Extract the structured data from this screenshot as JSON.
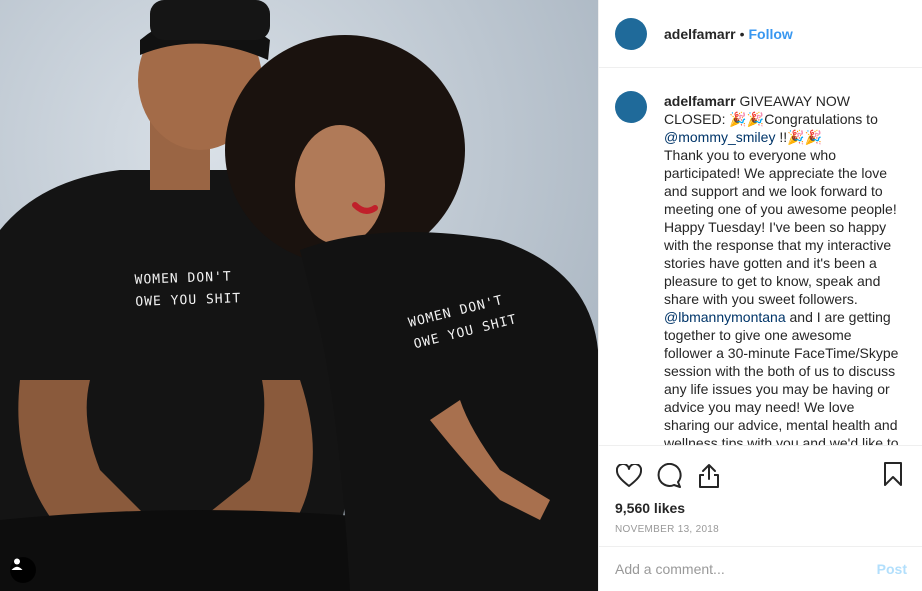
{
  "post": {
    "username": "adelfamarr",
    "follow_label": "Follow",
    "separator": "•",
    "avatar_color": "#1f6a9a"
  },
  "photo": {
    "shirt_text_left": "WOMEN DON'T\nOWE YOU SHIT",
    "shirt_text_right": "WOMEN DON'T\nOWE YOU SHIT",
    "user_tag_icon": "person-icon"
  },
  "caption": {
    "username": "adelfamarr",
    "line1": "GIVEAWAY NOW CLOSED:",
    "emoji": "🎉🎉",
    "congrats": "Congratulations to",
    "mention1": "@mommy_smiley",
    "after_mention1": " !!🎉🎉",
    "paragraph1": "Thank you to everyone who participated! We appreciate the love and support and we look forward to meeting one of you awesome people! Happy Tuesday! I've been so happy with the response that my interactive stories have gotten and it's been a pleasure to get to know, speak and share with you sweet followers.",
    "mention2": "@lbmannymontana",
    "paragraph2": " and I are getting together to give one awesome follower a 30-minute FaceTime/Skype session with the both of us to discuss any life issues you may be having or advice you may need! We love sharing our advice, mental health and wellness tips with you and we'd like to take it a"
  },
  "actions": {
    "like_icon": "heart-icon",
    "comment_icon": "comment-icon",
    "share_icon": "share-icon",
    "save_icon": "bookmark-icon",
    "likes": "9,560 likes",
    "date": "November 13, 2018"
  },
  "comment": {
    "placeholder": "Add a comment...",
    "post_label": "Post"
  },
  "colors": {
    "accent": "#3897f0",
    "post_disabled": "#b2dffc",
    "mention": "#003569"
  }
}
